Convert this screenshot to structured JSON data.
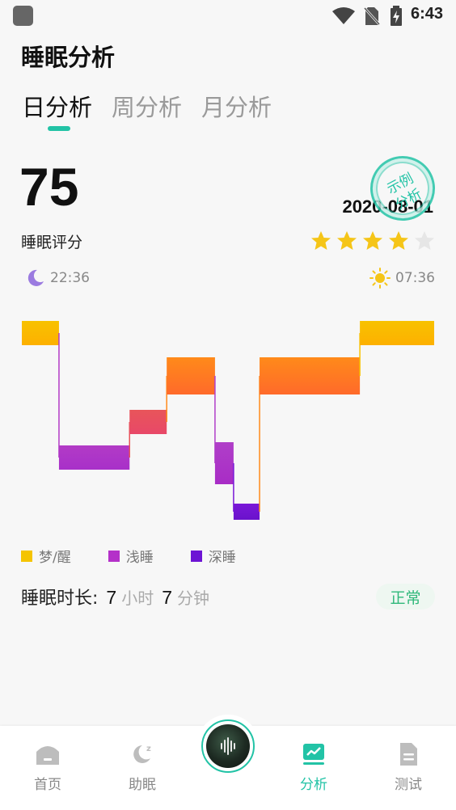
{
  "status_bar": {
    "time": "6:43",
    "icons": [
      "app-icon",
      "wifi-icon",
      "no-sim-icon",
      "battery-charging-icon"
    ]
  },
  "page_title": "睡眠分析",
  "tabs": [
    {
      "label": "日分析",
      "active": true
    },
    {
      "label": "周分析",
      "active": false
    },
    {
      "label": "月分析",
      "active": false
    }
  ],
  "score": {
    "value": "75",
    "label": "睡眠评分"
  },
  "date": "2020-08-01",
  "stamp": {
    "line1": "示例",
    "line2": "分析"
  },
  "rating": {
    "filled": 4,
    "total": 5,
    "filled_color": "#f5c518",
    "empty_color": "#e6e6e6"
  },
  "bedtime": "22:36",
  "waketime": "07:36",
  "hypnogram": {
    "levels": [
      "梦/醒",
      "浅睡",
      "深睡"
    ],
    "segments": [
      {
        "stage": "awake",
        "duration": 1.0
      },
      {
        "stage": "light",
        "duration": 1.9
      },
      {
        "stage": "light-high",
        "duration": 1.0
      },
      {
        "stage": "rem",
        "duration": 1.3
      },
      {
        "stage": "light",
        "duration": 0.5
      },
      {
        "stage": "deep",
        "duration": 0.7
      },
      {
        "stage": "rem",
        "duration": 2.7
      },
      {
        "stage": "awake",
        "duration": 2.0
      }
    ]
  },
  "legend": [
    {
      "label": "梦/醒",
      "color": "#f5c400"
    },
    {
      "label": "浅睡",
      "color": "#b431c9"
    },
    {
      "label": "深睡",
      "color": "#6d14d4"
    }
  ],
  "duration": {
    "label": "睡眠时长:",
    "hours": "7",
    "hours_unit": "小时",
    "minutes": "7",
    "minutes_unit": "分钟"
  },
  "status": "正常",
  "bottom_nav": [
    {
      "label": "首页",
      "icon": "home-icon",
      "active": false
    },
    {
      "label": "助眠",
      "icon": "sleep-moon-icon",
      "active": false
    },
    {
      "label": "分析",
      "icon": "analysis-chart-icon",
      "active": true
    },
    {
      "label": "测试",
      "icon": "test-document-icon",
      "active": false
    }
  ],
  "accent_color": "#22c3a6"
}
